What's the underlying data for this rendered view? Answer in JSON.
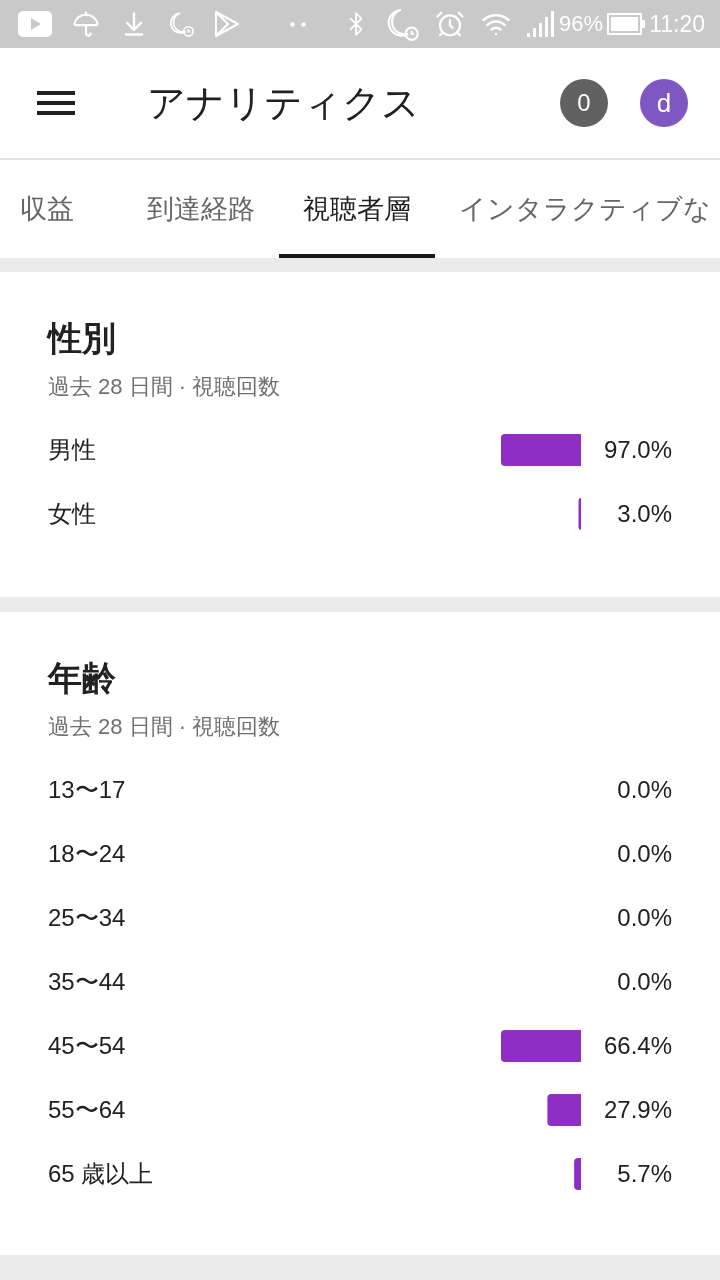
{
  "status_bar": {
    "battery": "96%",
    "time": "11:20"
  },
  "app_bar": {
    "title": "アナリティクス",
    "notification_count": "0",
    "avatar_letter": "d"
  },
  "tabs": [
    {
      "label": "収益",
      "selected": false
    },
    {
      "label": "到達経路",
      "selected": false
    },
    {
      "label": "視聴者層",
      "selected": true
    },
    {
      "label": "インタラクティブな",
      "selected": false
    }
  ],
  "sections": [
    {
      "title": "性別",
      "subtitle": "過去 28 日間 · 視聴回数",
      "chart_data": {
        "type": "bar",
        "orientation": "horizontal",
        "categories": [
          "男性",
          "女性"
        ],
        "values": [
          97.0,
          3.0
        ],
        "xlim": [
          97.0,
          0
        ],
        "value_labels": [
          "97.0%",
          "3.0%"
        ]
      }
    },
    {
      "title": "年齢",
      "subtitle": "過去 28 日間 · 視聴回数",
      "chart_data": {
        "type": "bar",
        "orientation": "horizontal",
        "categories": [
          "13〜17",
          "18〜24",
          "25〜34",
          "35〜44",
          "45〜54",
          "55〜64",
          "65 歳以上"
        ],
        "values": [
          0.0,
          0.0,
          0.0,
          0.0,
          66.4,
          27.9,
          5.7
        ],
        "xlim": [
          66.4,
          0
        ],
        "value_labels": [
          "0.0%",
          "0.0%",
          "0.0%",
          "0.0%",
          "66.4%",
          "27.9%",
          "5.7%"
        ]
      }
    }
  ]
}
